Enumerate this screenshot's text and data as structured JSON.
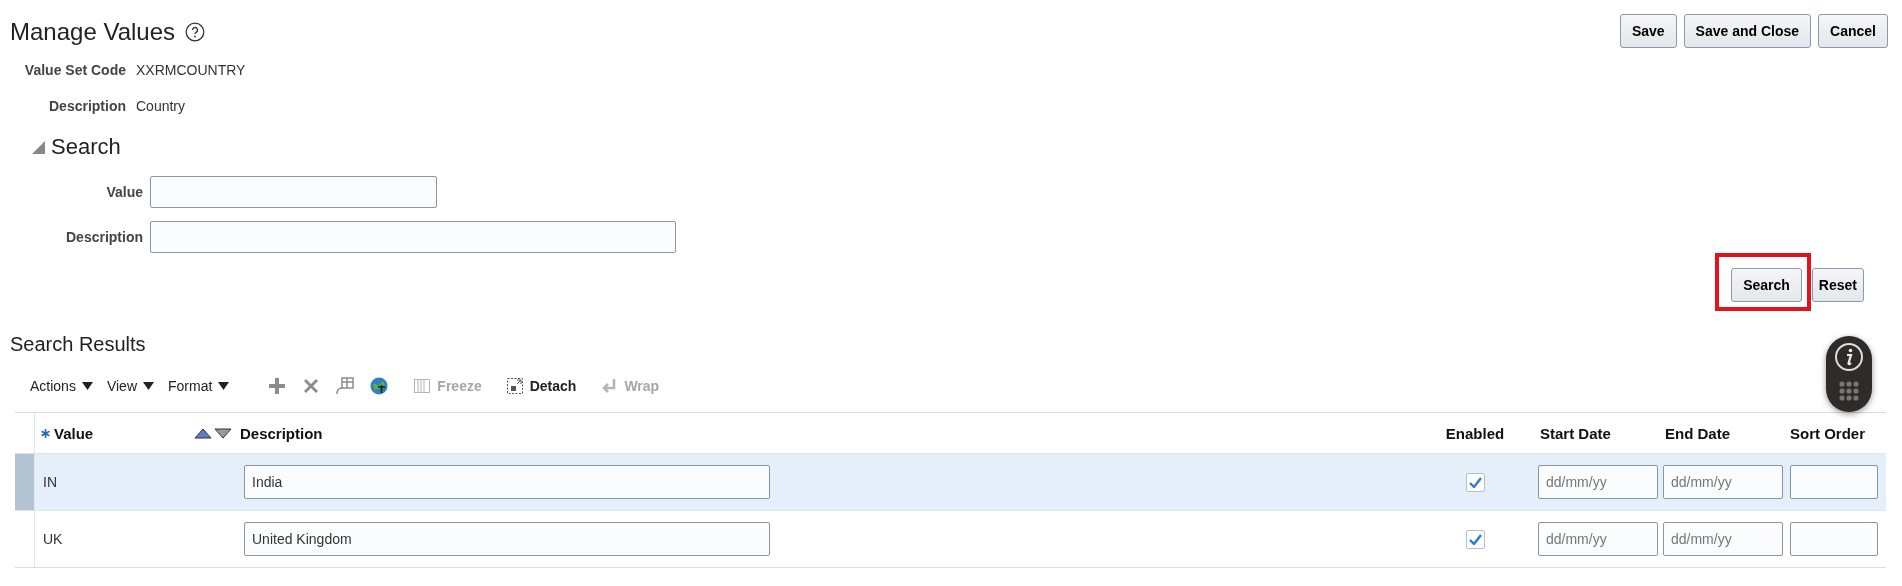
{
  "page": {
    "title": "Manage Values"
  },
  "header_buttons": [
    {
      "label": "Save"
    },
    {
      "label": "Save and Close"
    },
    {
      "label": "Cancel"
    }
  ],
  "details": [
    {
      "label": "Value Set Code",
      "value": "XXRMCOUNTRY"
    },
    {
      "label": "Description",
      "value": "Country"
    }
  ],
  "search": {
    "title": "Search",
    "expanded": true,
    "fields": [
      {
        "label": "Value"
      },
      {
        "label": "Description"
      }
    ],
    "buttons": [
      {
        "label": "Search",
        "highlighted": true
      },
      {
        "label": "Reset",
        "highlighted": false
      }
    ]
  },
  "results": {
    "title": "Search Results",
    "menus": [
      {
        "label": "Actions"
      },
      {
        "label": "View"
      },
      {
        "label": "Format"
      }
    ],
    "tools": [
      {
        "kind": "add",
        "disabled": false
      },
      {
        "kind": "delete",
        "disabled": false
      },
      {
        "kind": "table",
        "disabled": false
      },
      {
        "kind": "globe",
        "disabled": false
      }
    ],
    "text_tools": [
      {
        "kind": "freeze",
        "label": "Freeze",
        "disabled": true
      },
      {
        "kind": "detach",
        "label": "Detach",
        "disabled": false
      },
      {
        "kind": "wrap",
        "label": "Wrap",
        "disabled": true
      }
    ],
    "columns": [
      {
        "label": "Value",
        "required": true,
        "sortable": true
      },
      {
        "label": "Description",
        "required": false,
        "sortable": false
      },
      {
        "label": "Enabled",
        "required": false,
        "sortable": false
      },
      {
        "label": "Start Date",
        "required": false,
        "sortable": false
      },
      {
        "label": "End Date",
        "required": false,
        "sortable": false
      },
      {
        "label": "Sort Order",
        "required": false,
        "sortable": false
      }
    ],
    "rows": [
      {
        "value": "IN",
        "description": "India",
        "enabled": true,
        "start_date_placeholder": "dd/mm/yy",
        "end_date_placeholder": "dd/mm/yy",
        "selected": true
      },
      {
        "value": "UK",
        "description": "United Kingdom",
        "enabled": true,
        "start_date_placeholder": "dd/mm/yy",
        "end_date_placeholder": "dd/mm/yy",
        "selected": false
      }
    ]
  }
}
